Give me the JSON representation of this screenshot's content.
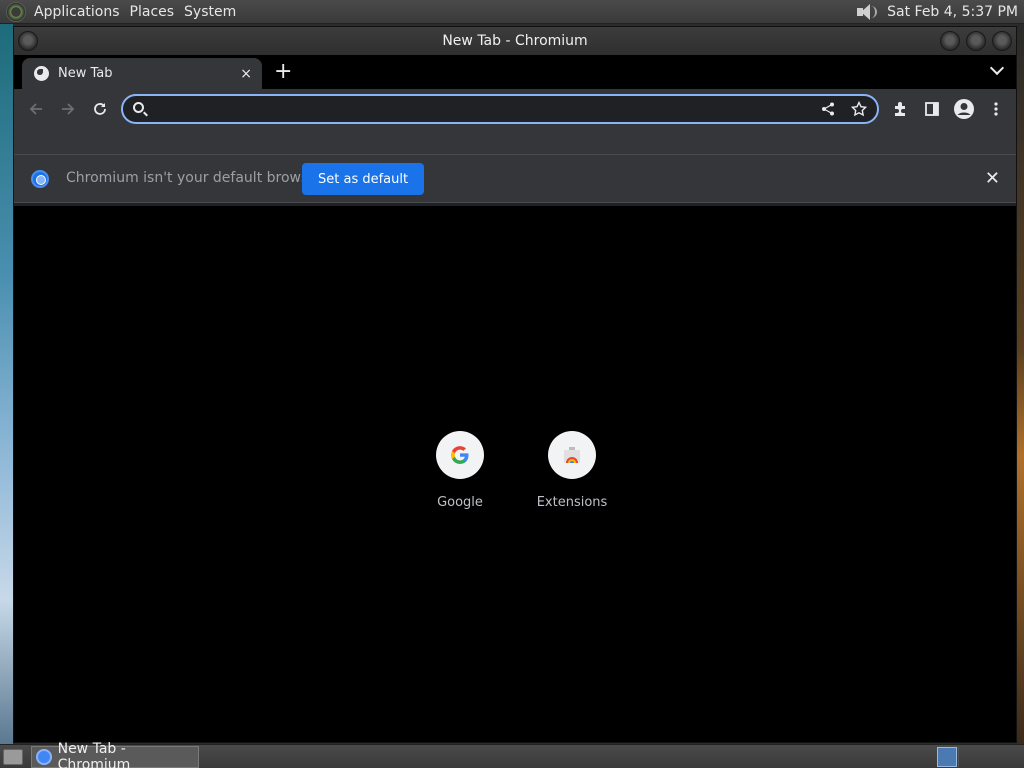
{
  "top_panel": {
    "menus": [
      "Applications",
      "Places",
      "System"
    ],
    "clock": "Sat Feb  4,  5:37 PM"
  },
  "window": {
    "title": "New Tab - Chromium"
  },
  "tab": {
    "title": "New Tab",
    "close_label": "×",
    "new_tab_label": "+"
  },
  "omnibox": {
    "value": "",
    "placeholder": ""
  },
  "infobar": {
    "message": "Chromium isn't your default browser",
    "button_label": "Set as default",
    "close_label": "✕"
  },
  "shortcuts": [
    {
      "label": "Google",
      "glyph": "G"
    },
    {
      "label": "Extensions",
      "glyph": "▲"
    }
  ],
  "taskbar": {
    "item_label": "New Tab - Chromium"
  },
  "colors": {
    "accent": "#8ab4f8",
    "button": "#1a73e8",
    "content_bg": "#000000"
  }
}
